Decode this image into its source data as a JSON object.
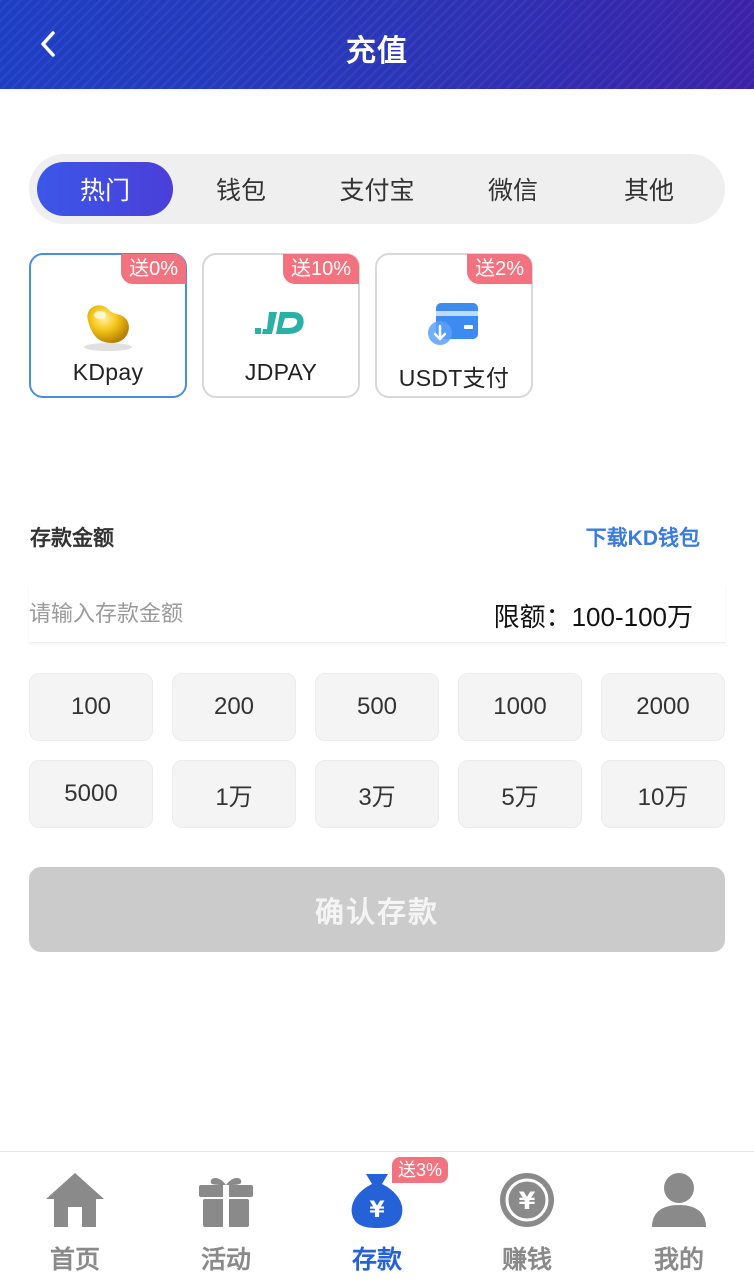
{
  "header": {
    "title": "充值",
    "back_icon": "chevron-left-icon"
  },
  "tabs": [
    {
      "label": "热门",
      "active": true
    },
    {
      "label": "钱包",
      "active": false
    },
    {
      "label": "支付宝",
      "active": false
    },
    {
      "label": "微信",
      "active": false
    },
    {
      "label": "其他",
      "active": false
    }
  ],
  "payment_methods": [
    {
      "name": "KDpay",
      "badge": "送0%",
      "icon": "gold-bean-icon",
      "selected": true
    },
    {
      "name": "JDPAY",
      "badge": "送10%",
      "icon": "jdpay-logo-icon",
      "selected": false
    },
    {
      "name": "USDT支付",
      "badge": "送2%",
      "icon": "card-download-icon",
      "selected": false
    }
  ],
  "amount": {
    "label": "存款金额",
    "download_link": "下载KD钱包",
    "placeholder": "请输入存款金额",
    "value": "",
    "limit": "限额：100-100万"
  },
  "quick_amounts": [
    "100",
    "200",
    "500",
    "1000",
    "2000",
    "5000",
    "1万",
    "3万",
    "5万",
    "10万"
  ],
  "confirm_label": "确认存款",
  "bottom_nav": {
    "items": [
      {
        "label": "首页",
        "icon": "home-icon",
        "active": false
      },
      {
        "label": "活动",
        "icon": "gift-icon",
        "active": false
      },
      {
        "label": "存款",
        "icon": "money-bag-icon",
        "active": true
      },
      {
        "label": "赚钱",
        "icon": "yuan-coin-icon",
        "active": false
      },
      {
        "label": "我的",
        "icon": "user-icon",
        "active": false
      }
    ],
    "deposit_badge": "送3%"
  },
  "colors": {
    "header_start": "#1e3fc4",
    "header_end": "#3b22a8",
    "accent_blue": "#3a7be0",
    "badge_red": "#f2737f",
    "disabled_gray": "#cbcbcb"
  }
}
